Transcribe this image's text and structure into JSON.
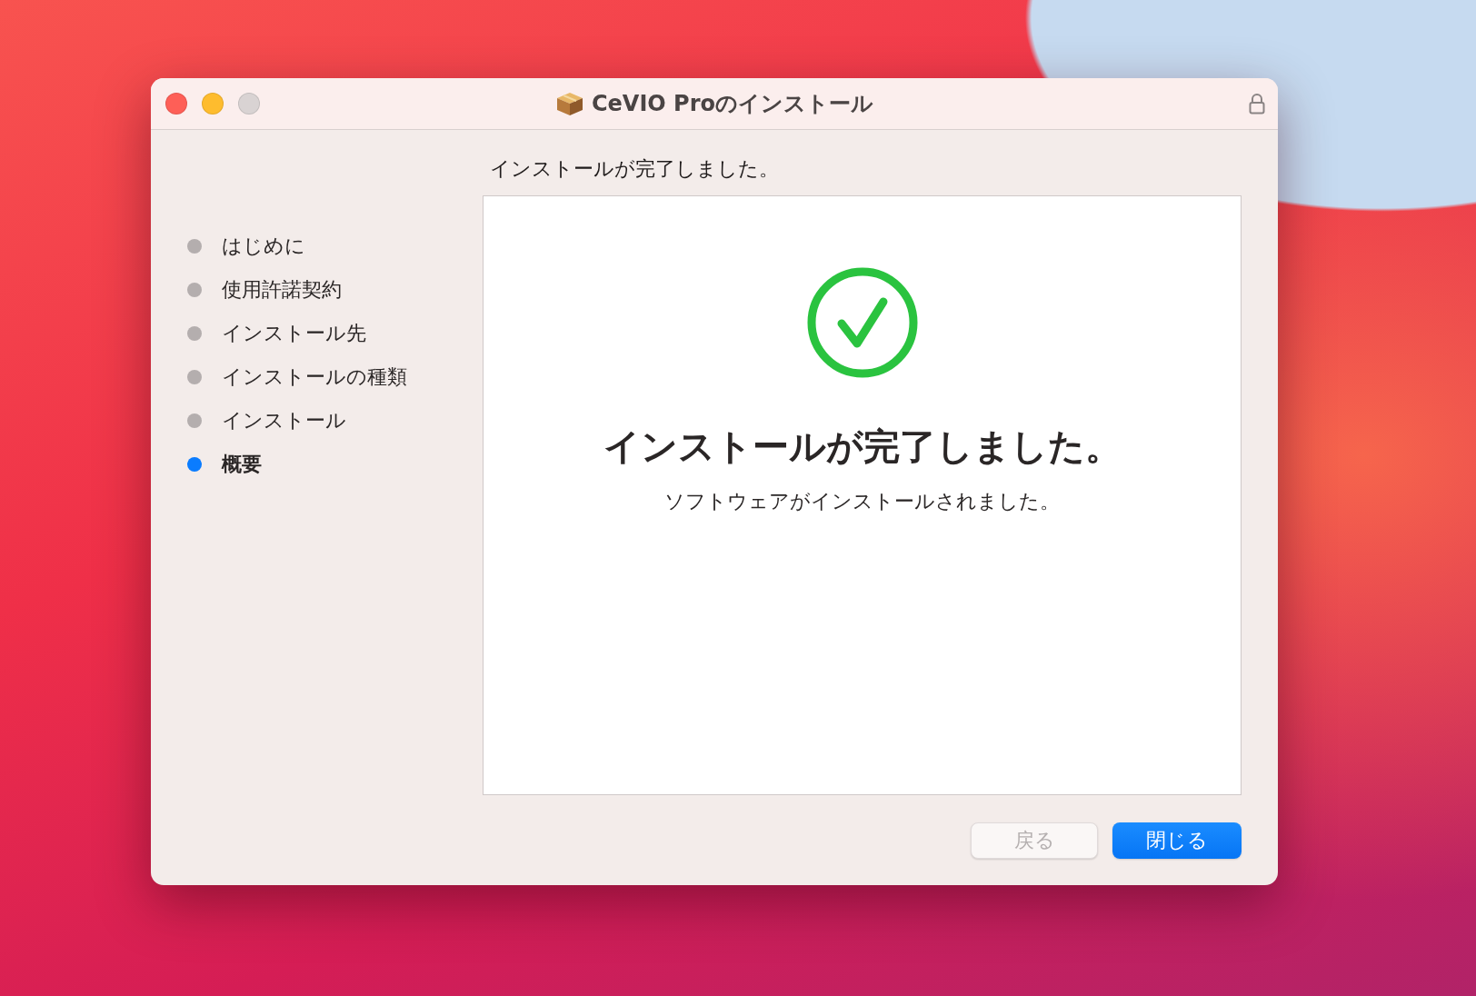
{
  "window": {
    "title": "CeVIO Proのインストール"
  },
  "steps": [
    {
      "label": "はじめに",
      "selected": false
    },
    {
      "label": "使用許諾契約",
      "selected": false
    },
    {
      "label": "インストール先",
      "selected": false
    },
    {
      "label": "インストールの種類",
      "selected": false
    },
    {
      "label": "インストール",
      "selected": false
    },
    {
      "label": "概要",
      "selected": true
    }
  ],
  "header": "インストールが完了しました。",
  "result": {
    "title": "インストールが完了しました。",
    "message": "ソフトウェアがインストールされました。"
  },
  "buttons": [
    {
      "label": "戻る",
      "kind": "secondary",
      "disabled": true
    },
    {
      "label": "閉じる",
      "kind": "primary",
      "disabled": false
    }
  ]
}
